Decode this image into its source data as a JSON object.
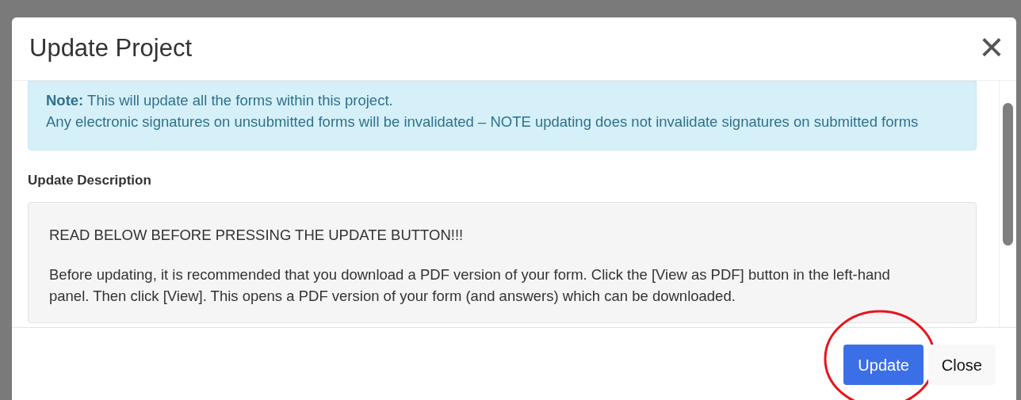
{
  "dialog": {
    "title": "Update Project",
    "close_icon": "×",
    "note": {
      "lines": [
        "**Note:** This will update all the forms within this project.",
        "Any electronic signatures on unsubmitted forms will be invalidated – NOTE updating does not invalidate signatures on submitted forms"
      ]
    },
    "description": {
      "label": "Update Description",
      "paragraphs": [
        "READ BELOW BEFORE PRESSING THE UPDATE BUTTON!!!",
        "Before updating, it is recommended that you download a PDF version of your form. Click the [View as PDF] button in the left-hand panel. Then click [View]. This opens a PDF version of your form (and answers) which can be downloaded."
      ]
    },
    "buttons": [
      {
        "label": "Update",
        "kind": "primary",
        "highlighted": true
      },
      {
        "label": "Close",
        "kind": "secondary",
        "highlighted": false
      }
    ]
  }
}
